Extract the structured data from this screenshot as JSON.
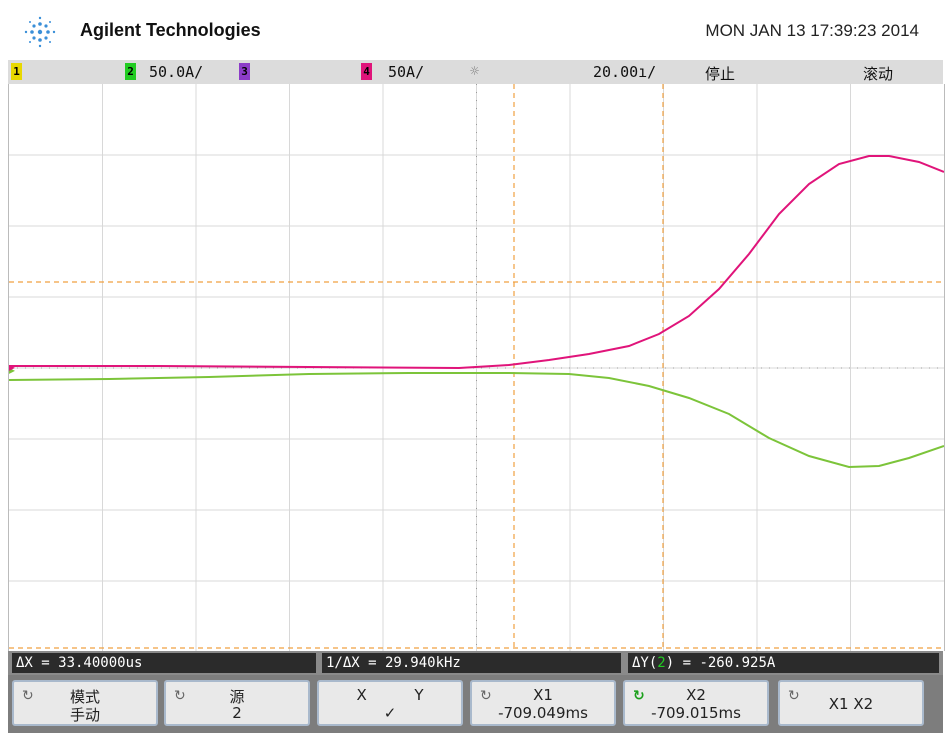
{
  "header": {
    "brand": "Agilent Technologies",
    "datetime": "MON JAN 13 17:39:23 2014",
    "logo_icon": "agilent-spark-icon"
  },
  "status_bar": {
    "ch1": "1",
    "ch2": "2",
    "ch2_scale": "50.0A/",
    "ch3": "3",
    "ch4": "4",
    "ch4_scale": "50A/",
    "trigger_icon": "trigger-sun-icon",
    "timebase": "20.00ı/",
    "run_state": "停止",
    "mode": "滚动",
    "colors": {
      "ch1": "#e8d800",
      "ch2": "#22cc22",
      "ch3": "#8c3cc8",
      "ch4": "#e0147a"
    }
  },
  "traces": {
    "pink": "#e0147a",
    "green": "#7cc43a",
    "cursor": "#f0a040"
  },
  "measurements": {
    "delta_x": "ΔX = 33.40000us",
    "inv_delta_x": "1/ΔX = 29.940kHz",
    "delta_y_prefix": "ΔY(",
    "delta_y_channel": "2",
    "delta_y_suffix": ") = -260.925A"
  },
  "softkeys": [
    {
      "line1": "模式",
      "line2": "手动"
    },
    {
      "line1": "源",
      "line2": "2"
    },
    {
      "line1": "X          Y",
      "line2": "✓"
    },
    {
      "line1": "X1",
      "line2": "-709.049ms"
    },
    {
      "line1": "X2",
      "line2": "-709.015ms"
    },
    {
      "line1": "X1 X2",
      "line2": ""
    }
  ]
}
